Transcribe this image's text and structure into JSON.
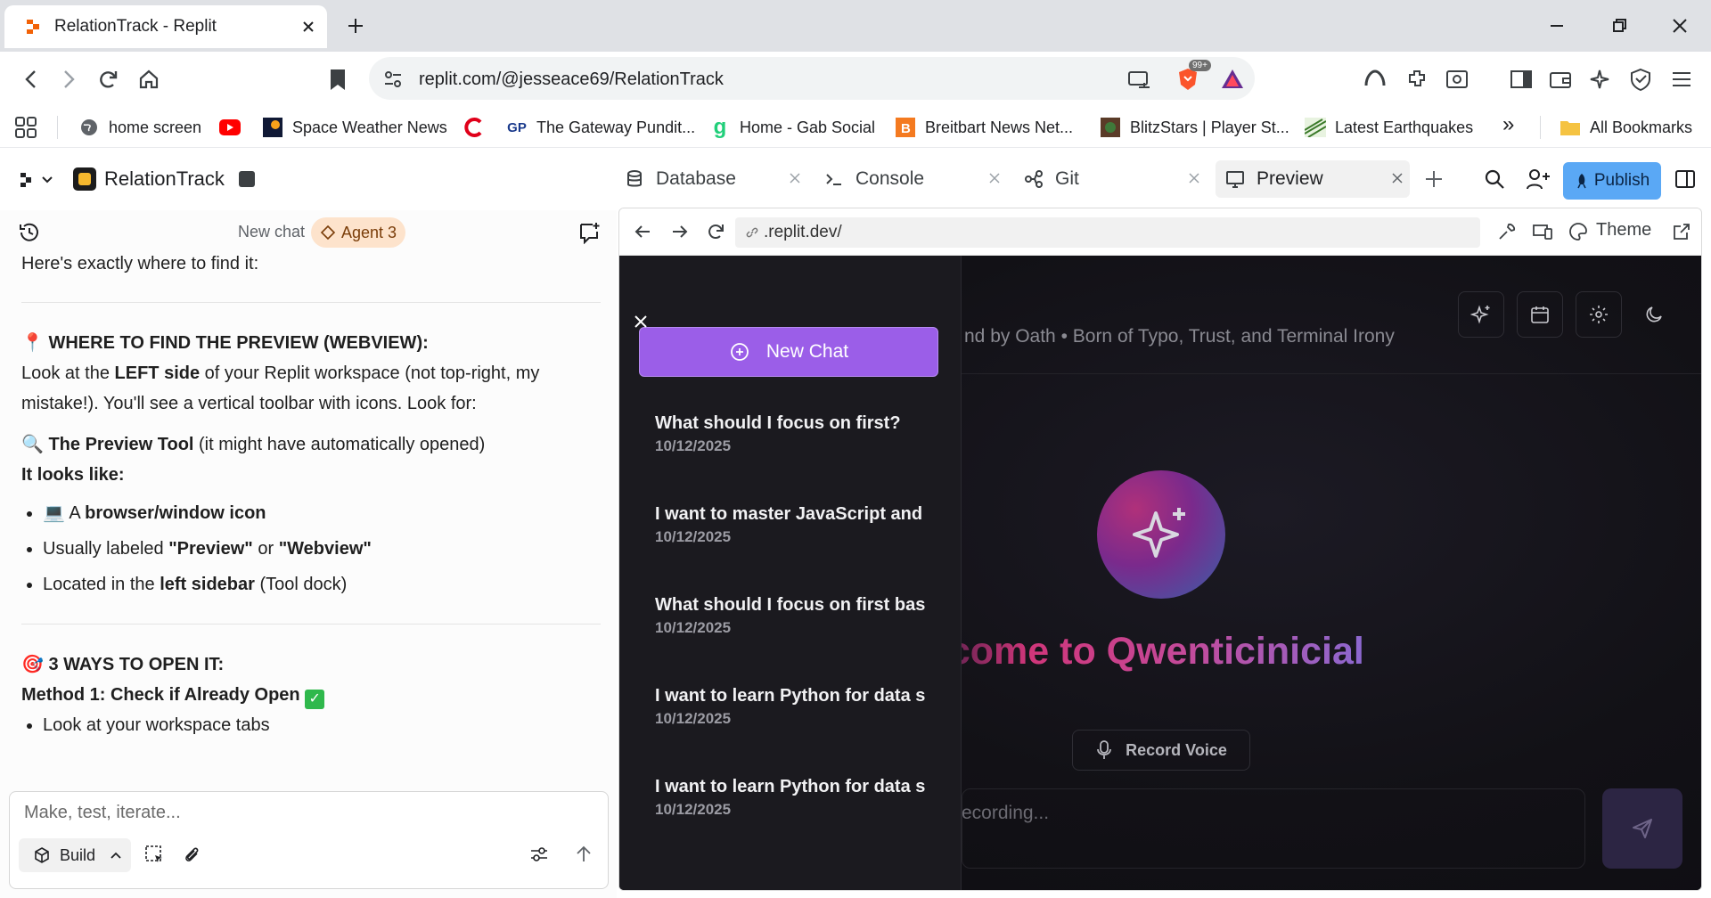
{
  "browser": {
    "tab_title": "RelationTrack - Replit",
    "url": "replit.com/@jesseace69/RelationTrack",
    "brave_badge": "99+"
  },
  "bookmarks": [
    {
      "label": "home screen",
      "icon": "globe-icon"
    },
    {
      "label": "",
      "icon": "youtube-icon"
    },
    {
      "label": "Space Weather News",
      "icon": "space-weather-icon"
    },
    {
      "label": "",
      "icon": "c-logo-icon"
    },
    {
      "label": "The Gateway Pundit...",
      "icon": "gp-icon"
    },
    {
      "label": "Home - Gab Social",
      "icon": "gab-icon"
    },
    {
      "label": "Breitbart News Net...",
      "icon": "breitbart-icon"
    },
    {
      "label": "BlitzStars | Player St...",
      "icon": "blitzstars-icon"
    },
    {
      "label": "Latest Earthquakes",
      "icon": "earthquake-icon"
    }
  ],
  "bookmarks_more": "»",
  "all_bookmarks": "All Bookmarks",
  "replit": {
    "project_name": "RelationTrack",
    "tabs": [
      {
        "label": "Database",
        "icon": "database-icon"
      },
      {
        "label": "Console",
        "icon": "console-icon"
      },
      {
        "label": "Git",
        "icon": "git-icon"
      },
      {
        "label": "Preview",
        "icon": "preview-icon"
      }
    ],
    "publish_label": "Publish"
  },
  "chat": {
    "new_chat_label": "New chat",
    "agent_label": "Agent 3",
    "intro": "Here's exactly where to find it:",
    "where_heading": "WHERE TO FIND THE PREVIEW (WEBVIEW):",
    "look_prefix": "Look at the ",
    "look_bold": "LEFT side",
    "look_suffix": " of your Replit workspace (not top-right, my mistake!). You'll see a vertical toolbar with icons. Look for:",
    "tool_bold": "The Preview Tool",
    "tool_suffix": " (it might have automatically opened)",
    "looks_like": "It looks like:",
    "bullet1_prefix": " A ",
    "bullet1_bold": "browser/window icon",
    "bullet2_prefix": "Usually labeled ",
    "bullet2_bold1": "\"Preview\"",
    "bullet2_mid": " or ",
    "bullet2_bold2": "\"Webview\"",
    "bullet3_prefix": "Located in the ",
    "bullet3_bold": "left sidebar",
    "bullet3_suffix": " (Tool dock)",
    "ways_heading": "3 WAYS TO OPEN IT:",
    "method1": "Method 1: Check if Already Open",
    "bullet4": "Look at your workspace tabs",
    "input_placeholder": "Make, test, iterate...",
    "build_label": "Build"
  },
  "preview": {
    "url": ".replit.dev/",
    "theme_label": "Theme",
    "app": {
      "tagline": "nd by Oath • Born of Typo, Trust, and Terminal Irony",
      "welcome": "elcome to Qwenticinicial",
      "record_label": "Record Voice",
      "input_placeholder": "ecording...",
      "new_chat_label": "New Chat",
      "chats": [
        {
          "title": "What should I focus on first?",
          "date": "10/12/2025"
        },
        {
          "title": "I want to master JavaScript and",
          "date": "10/12/2025"
        },
        {
          "title": "What should I focus on first bas",
          "date": "10/12/2025"
        },
        {
          "title": "I want to learn Python for data s",
          "date": "10/12/2025"
        },
        {
          "title": "I want to learn Python for data s",
          "date": "10/12/2025"
        }
      ]
    }
  },
  "colors": {
    "publish": "#5aa8f5",
    "new_chat": "#9b5ee8",
    "agent_pill": "#fde3cc"
  }
}
